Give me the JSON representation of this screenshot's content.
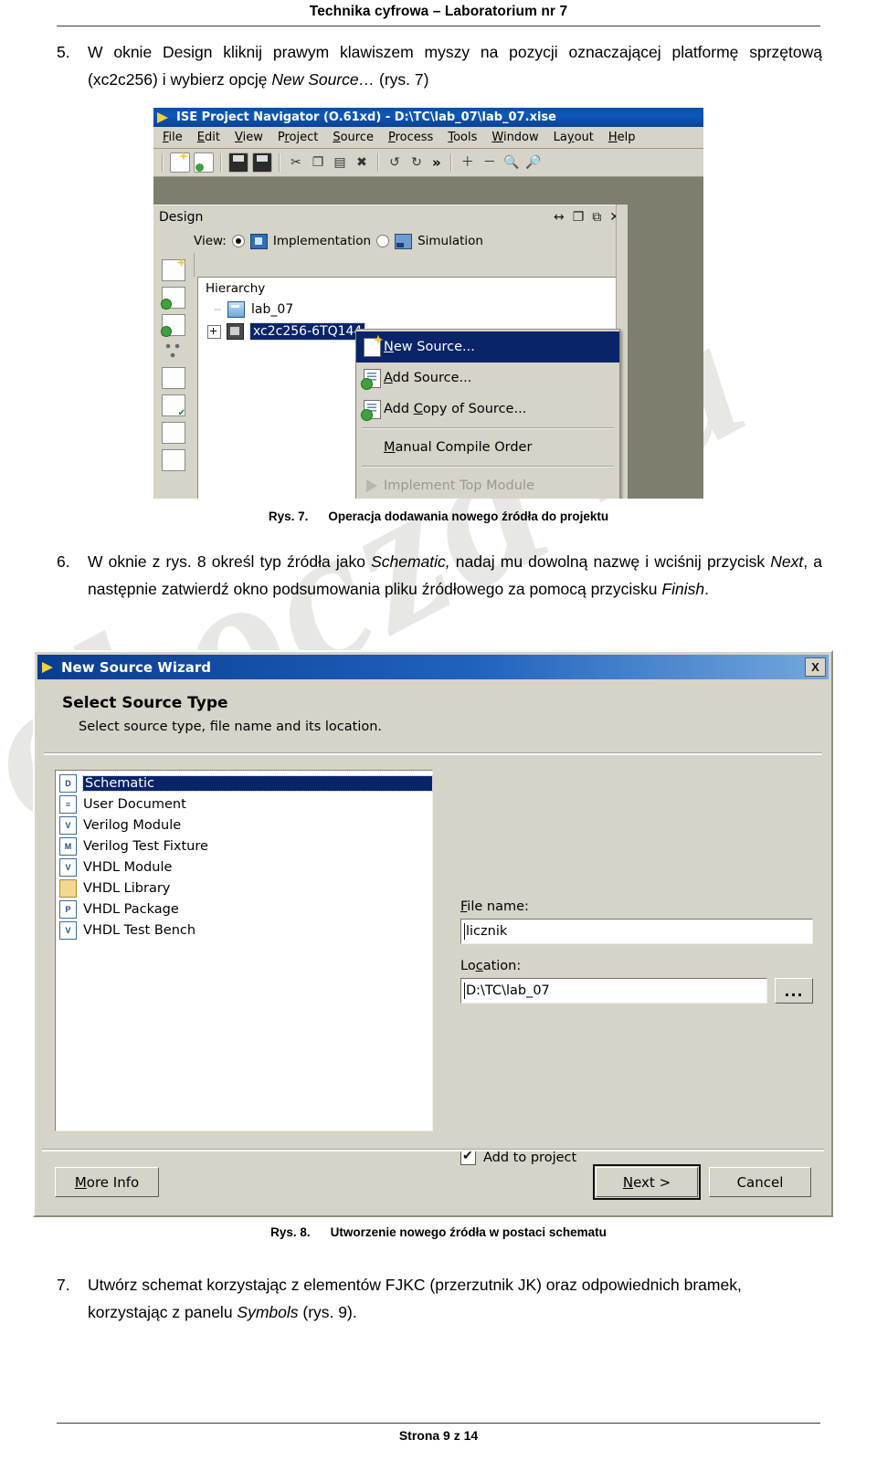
{
  "page": {
    "header": "Technika cyfrowa – Laboratorium nr 7",
    "footer": "Strona 9 z 14"
  },
  "watermark": {
    "text1": "za",
    "text2": "obocza"
  },
  "items": {
    "item5": {
      "num": "5.",
      "part1": "W oknie Design kliknij prawym klawiszem myszy na pozycji oznaczającej platformę sprzętową (xc2c256) i wybierz opcję ",
      "em1": "New Source…",
      "part2": " (rys. 7)"
    },
    "item6": {
      "num": "6.",
      "part1": "W oknie z rys. 8 określ typ źródła jako ",
      "em1": "Schematic,",
      "part2": " nadaj mu dowolną nazwę i wciśnij przycisk ",
      "em2": "Next",
      "part3": ", a następnie zatwierdź okno podsumowania pliku źródłowego za pomocą przycisku ",
      "em3": "Finish",
      "part4": "."
    },
    "item7": {
      "num": "7.",
      "part1": "Utwórz schemat korzystając z elementów FJKC (przerzutnik JK) oraz odpowiednich bramek, korzystając z panelu ",
      "em1": "Symbols",
      "part2": " (rys. 9)."
    }
  },
  "captions": {
    "fig7": {
      "num": "Rys. 7.",
      "text": "Operacja dodawania nowego źródła do projektu"
    },
    "fig8": {
      "num": "Rys. 8.",
      "text": "Utworzenie nowego źródła w postaci schematu"
    }
  },
  "ise_window": {
    "title": "ISE Project Navigator (O.61xd) - D:\\TC\\lab_07\\lab_07.xise",
    "menus": [
      {
        "pre": "",
        "acc": "F",
        "post": "ile"
      },
      {
        "pre": "",
        "acc": "E",
        "post": "dit"
      },
      {
        "pre": "",
        "acc": "V",
        "post": "iew"
      },
      {
        "pre": "P",
        "acc": "r",
        "post": "oject"
      },
      {
        "pre": "",
        "acc": "S",
        "post": "ource"
      },
      {
        "pre": "",
        "acc": "P",
        "post": "rocess"
      },
      {
        "pre": "",
        "acc": "T",
        "post": "ools"
      },
      {
        "pre": "",
        "acc": "W",
        "post": "indow"
      },
      {
        "pre": "La",
        "acc": "y",
        "post": "out"
      },
      {
        "pre": "",
        "acc": "H",
        "post": "elp"
      }
    ],
    "design_panel": {
      "title": "Design",
      "view_label": "View:",
      "view_implementation": "Implementation",
      "view_simulation": "Simulation",
      "hierarchy_header": "Hierarchy",
      "tree": [
        {
          "label": "lab_07",
          "selected": false
        },
        {
          "label": "xc2c256-6TQ144",
          "selected": true
        }
      ]
    },
    "context_menu": [
      {
        "pre": "",
        "acc": "N",
        "post": "ew Source...",
        "highlighted": true,
        "disabled": false,
        "icon": "new-source-icon"
      },
      {
        "pre": "",
        "acc": "A",
        "post": "dd Source...",
        "highlighted": false,
        "disabled": false,
        "icon": "add-source-icon"
      },
      {
        "pre": "Add ",
        "acc": "C",
        "post": "opy of Source...",
        "highlighted": false,
        "disabled": false,
        "icon": "add-copy-of-source-icon"
      },
      {
        "pre": "",
        "acc": "M",
        "post": "anual Compile Order",
        "highlighted": false,
        "disabled": false,
        "icon": "manual-compile-order-icon"
      },
      {
        "pre": "",
        "acc": "",
        "post": "Implement Top Module",
        "highlighted": false,
        "disabled": true,
        "icon": "implement-top-module-icon"
      }
    ]
  },
  "wizard": {
    "title": "New Source Wizard",
    "close_label": "X",
    "heading": "Select Source Type",
    "subheading": "Select source type, file name and its location.",
    "source_types": [
      {
        "label": "Schematic",
        "glyph": "D",
        "selected": true
      },
      {
        "label": "User Document",
        "glyph": "≡",
        "selected": false
      },
      {
        "label": "Verilog Module",
        "glyph": "V",
        "selected": false
      },
      {
        "label": "Verilog Test Fixture",
        "glyph": "M",
        "selected": false
      },
      {
        "label": "VHDL Module",
        "glyph": "V",
        "selected": false
      },
      {
        "label": "VHDL Library",
        "glyph": "",
        "selected": false
      },
      {
        "label": "VHDL Package",
        "glyph": "P",
        "selected": false
      },
      {
        "label": "VHDL Test Bench",
        "glyph": "V",
        "selected": false
      }
    ],
    "file_name_label_pre": "",
    "file_name_label_acc": "F",
    "file_name_label_post": "ile name:",
    "file_name_value": "licznik",
    "location_label_pre": "Lo",
    "location_label_acc": "c",
    "location_label_post": "ation:",
    "location_value": "D:\\TC\\lab_07",
    "browse_label": "...",
    "add_to_project_label": "Add to project",
    "add_to_project_checked": true,
    "buttons": {
      "more_info_pre": "",
      "more_info_acc": "M",
      "more_info_post": "ore Info",
      "next_pre": "",
      "next_acc": "N",
      "next_post": "ext >",
      "cancel": "Cancel"
    }
  }
}
